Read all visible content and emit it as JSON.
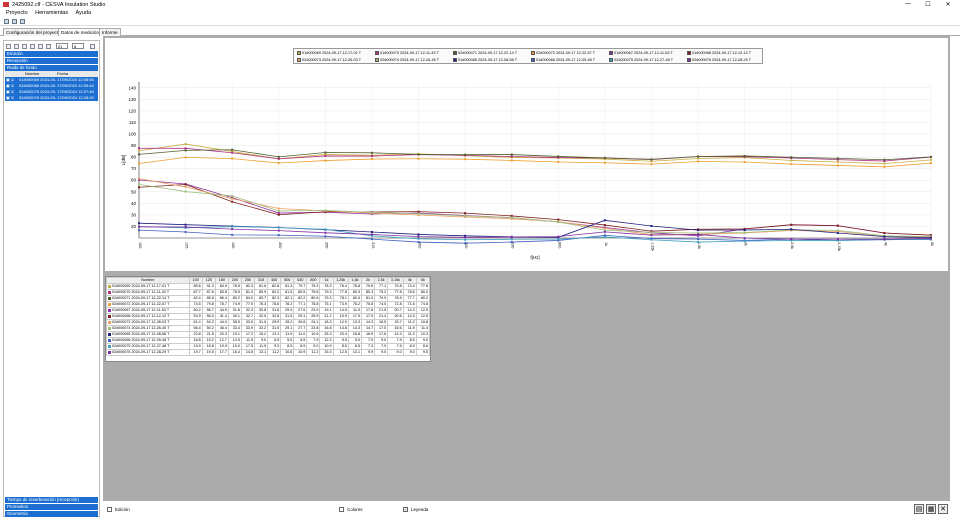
{
  "window": {
    "title": "2425092.clf - CESVA Insulation Studio",
    "minimize": "—",
    "maximize": "☐",
    "close": "✕"
  },
  "menu": [
    "Proyecto",
    "Herramientas",
    "Ayuda"
  ],
  "tabs": [
    "Configuración del proyecto",
    "Datos de medición",
    "Informe"
  ],
  "left": {
    "selects": [
      "01",
      "8"
    ],
    "sections": {
      "emission": "Emisión",
      "reception": "Recepción",
      "background": "Ruido de fondo"
    },
    "headers": {
      "name": "Nombre",
      "date": "Fecha"
    },
    "rows": [
      {
        "name": "01#000069 2024-09-",
        "date": "17/09/2024 12:08:06"
      },
      {
        "name": "02#000066 2024-09-",
        "date": "17/09/2024 12:09:48"
      },
      {
        "name": "02#000075 2024-09-",
        "date": "17/09/2024 12:27:48"
      },
      {
        "name": "02#000076 2024-09-",
        "date": "17/09/2024 12:28:29"
      }
    ],
    "bottom_sections": [
      "Tiempo de reverberación (recepción)",
      "Promedios",
      "Geometría"
    ]
  },
  "chart_data": {
    "type": "line",
    "xlabel": "f[Hz]",
    "ylabel": "L[dB]",
    "ylim": [
      10,
      145
    ],
    "yticks": [
      20,
      30,
      40,
      50,
      60,
      70,
      80,
      90,
      100,
      110,
      120,
      130,
      140
    ],
    "x": [
      "100",
      "125",
      "160",
      "200",
      "250",
      "315",
      "400",
      "500",
      "630",
      "800",
      "1k",
      "1,25k",
      "1,6k",
      "2k",
      "2,5k",
      "3,15k",
      "4k",
      "5k"
    ],
    "series": [
      {
        "name": "01#000069 2024-09-17 12-17-01 T",
        "color": "#c8b040",
        "values": [
          85.6,
          91.3,
          84.9,
          78.5,
          82.3,
          81.6,
          82.8,
          81.3,
          79.7,
          79.3,
          78.3,
          76.4,
          78.8,
          79.6,
          77.1,
          75.8,
          74.4,
          77.6
        ]
      },
      {
        "name": "01#000070 2024-09-17 12-11-43 T",
        "color": "#b03080",
        "values": [
          87.7,
          87.6,
          83.8,
          78.5,
          81.0,
          80.9,
          82.2,
          81.5,
          80.5,
          79.6,
          79.3,
          77.8,
          80.5,
          80.3,
          79.2,
          77.8,
          76.6,
          80.0
        ]
      },
      {
        "name": "02#000071 2024-09-17 12-22-14 T",
        "color": "#506030",
        "values": [
          82.4,
          85.8,
          86.4,
          80.2,
          84.0,
          83.7,
          82.3,
          82.1,
          82.2,
          80.6,
          79.3,
          78.1,
          80.5,
          81.0,
          79.9,
          78.9,
          77.7,
          80.2
        ]
      },
      {
        "name": "02#000072 2024-09-17 12-22-57 T",
        "color": "#f0a030",
        "values": [
          74.5,
          79.8,
          78.7,
          74.9,
          77.0,
          78.3,
          78.6,
          78.2,
          77.1,
          75.8,
          75.1,
          73.9,
          76.2,
          75.8,
          74.0,
          72.8,
          71.6,
          74.8
        ]
      },
      {
        "name": "01#000067 2024-09-17 12-11-53 T",
        "color": "#9030a0",
        "values": [
          60.2,
          56.7,
          44.9,
          31.6,
          32.3,
          30.8,
          31.6,
          29.4,
          27.6,
          23.9,
          19.1,
          14.5,
          11.9,
          17.8,
          21.5,
          20.7,
          14.3,
          12.5
        ]
      },
      {
        "name": "01#000068 2024-09-17 12-12-12 T",
        "color": "#802020",
        "values": [
          53.9,
          56.3,
          41.4,
          30.1,
          32.7,
          32.5,
          32.8,
          31.5,
          29.1,
          25.9,
          21.2,
          15.9,
          17.5,
          17.9,
          21.4,
          20.6,
          14.3,
          12.5
        ]
      },
      {
        "name": "02#000073 2024-09-17 12-26-03 T",
        "color": "#e8a060",
        "values": [
          61.4,
          54.2,
          44.0,
          35.5,
          33.5,
          31.5,
          29.9,
          28.2,
          26.6,
          24.1,
          18.3,
          12.9,
          13.3,
          14.3,
          16.5,
          15.7,
          11.2,
          10.8
        ]
      },
      {
        "name": "02#000074 2024-09-17 12-26-45 T",
        "color": "#a0c080",
        "values": [
          56.4,
          50.2,
          46.4,
          33.4,
          33.9,
          32.2,
          31.0,
          29.1,
          27.7,
          23.8,
          16.8,
          14.8,
          14.3,
          14.7,
          17.0,
          16.6,
          11.9,
          11.4
        ]
      },
      {
        "name": "01#000065 2024-09-17 12-08-56 T",
        "color": "#202080",
        "values": [
          22.8,
          21.5,
          20.3,
          19.1,
          17.2,
          15.2,
          13.1,
          11.9,
          11.0,
          10.6,
          25.3,
          20.4,
          16.8,
          16.9,
          17.6,
          14.3,
          11.2,
          10.3
        ]
      },
      {
        "name": "01#000066 2024-09-17 12-09-48 T",
        "color": "#4060c0",
        "values": [
          16.8,
          15.2,
          12.7,
          12.5,
          11.5,
          9.0,
          6.5,
          5.5,
          6.5,
          7.9,
          12.3,
          9.5,
          9.0,
          7.9,
          9.0,
          7.9,
          8.5,
          9.0
        ]
      },
      {
        "name": "02#000075 2024-09-17 12-27-48 T",
        "color": "#40a0c0",
        "values": [
          19.9,
          18.8,
          19.9,
          19.0,
          17.5,
          11.9,
          9.3,
          8.5,
          8.9,
          9.0,
          10.9,
          8.5,
          6.5,
          7.3,
          7.9,
          7.9,
          8.9,
          8.6
        ]
      },
      {
        "name": "02#000076 2024-09-17 12-28-29 T",
        "color": "#8030a0",
        "values": [
          19.7,
          19.5,
          17.7,
          16.4,
          14.5,
          13.1,
          11.2,
          10.6,
          10.9,
          11.2,
          15.3,
          12.5,
          13.1,
          9.9,
          9.0,
          9.0,
          9.0,
          9.5
        ]
      }
    ]
  },
  "grid": {
    "header": [
      "Nombre",
      "100",
      "125",
      "160",
      "200",
      "250",
      "315",
      "400",
      "500",
      "630",
      "800",
      "1k",
      "1,25k",
      "1,6k",
      "2k",
      "2,5k",
      "3,15k",
      "4k",
      "5k"
    ]
  },
  "status": {
    "edit": "Edición",
    "colors": "Colores",
    "legend": "Leyenda",
    "legend_checked": "✓"
  }
}
